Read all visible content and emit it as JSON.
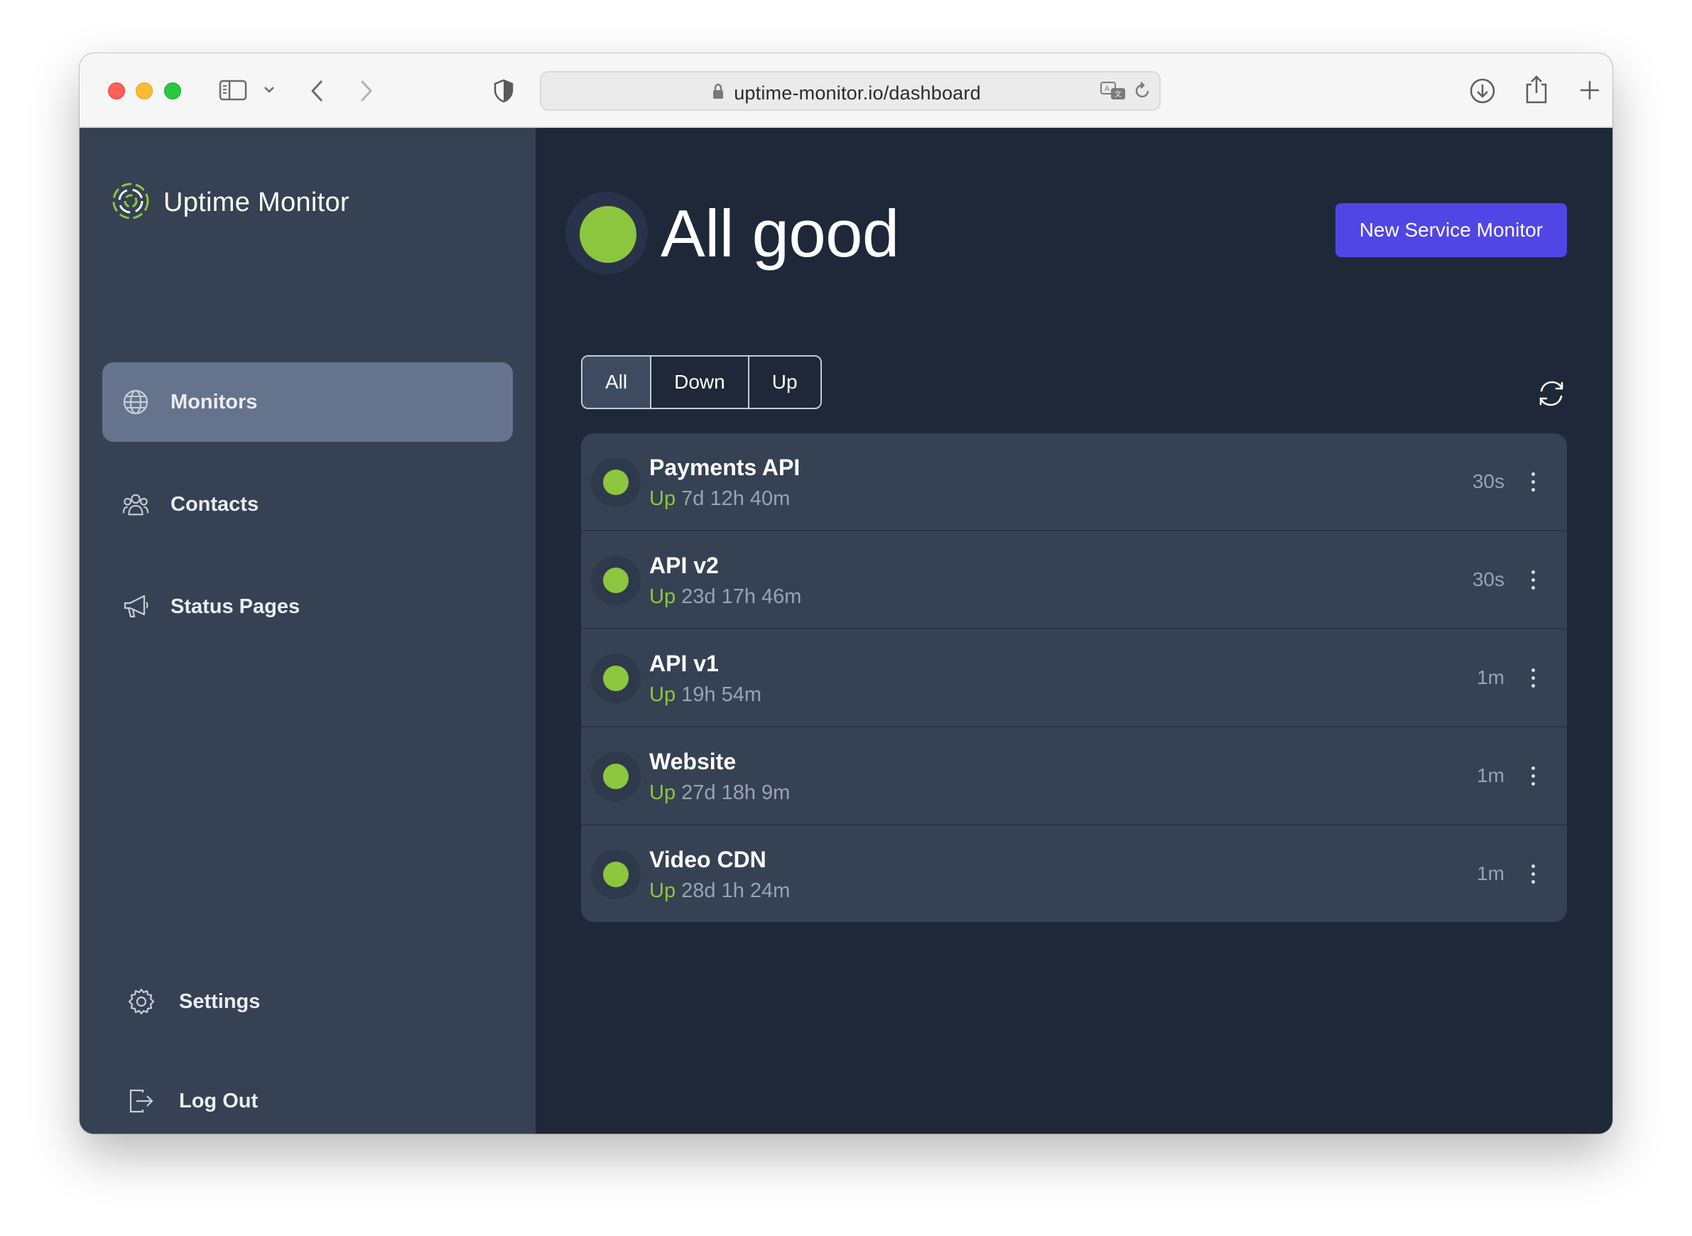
{
  "browser": {
    "url": "uptime-monitor.io/dashboard"
  },
  "sidebar": {
    "brand": "Uptime Monitor",
    "items": [
      {
        "label": "Monitors",
        "icon": "globe-icon",
        "active": true
      },
      {
        "label": "Contacts",
        "icon": "users-icon",
        "active": false
      },
      {
        "label": "Status Pages",
        "icon": "megaphone-icon",
        "active": false
      }
    ],
    "bottom_items": [
      {
        "label": "Settings",
        "icon": "gear-icon"
      },
      {
        "label": "Log Out",
        "icon": "logout-icon"
      }
    ]
  },
  "main": {
    "status_title": "All good",
    "status_color": "#8cc63f",
    "new_button_label": "New Service Monitor",
    "filters": [
      {
        "label": "All",
        "active": true
      },
      {
        "label": "Down",
        "active": false
      },
      {
        "label": "Up",
        "active": false
      }
    ],
    "monitors": [
      {
        "name": "Payments API",
        "status": "Up",
        "duration": "7d 12h 40m",
        "interval": "30s"
      },
      {
        "name": "API v2",
        "status": "Up",
        "duration": "23d 17h 46m",
        "interval": "30s"
      },
      {
        "name": "API v1",
        "status": "Up",
        "duration": "19h 54m",
        "interval": "1m"
      },
      {
        "name": "Website",
        "status": "Up",
        "duration": "27d 18h 9m",
        "interval": "1m"
      },
      {
        "name": "Video CDN",
        "status": "Up",
        "duration": "28d 1h 24m",
        "interval": "1m"
      }
    ]
  },
  "colors": {
    "accent": "#4f46e5",
    "up": "#8cc63f",
    "sidebar_bg": "#364153",
    "main_bg": "#1f2839"
  }
}
